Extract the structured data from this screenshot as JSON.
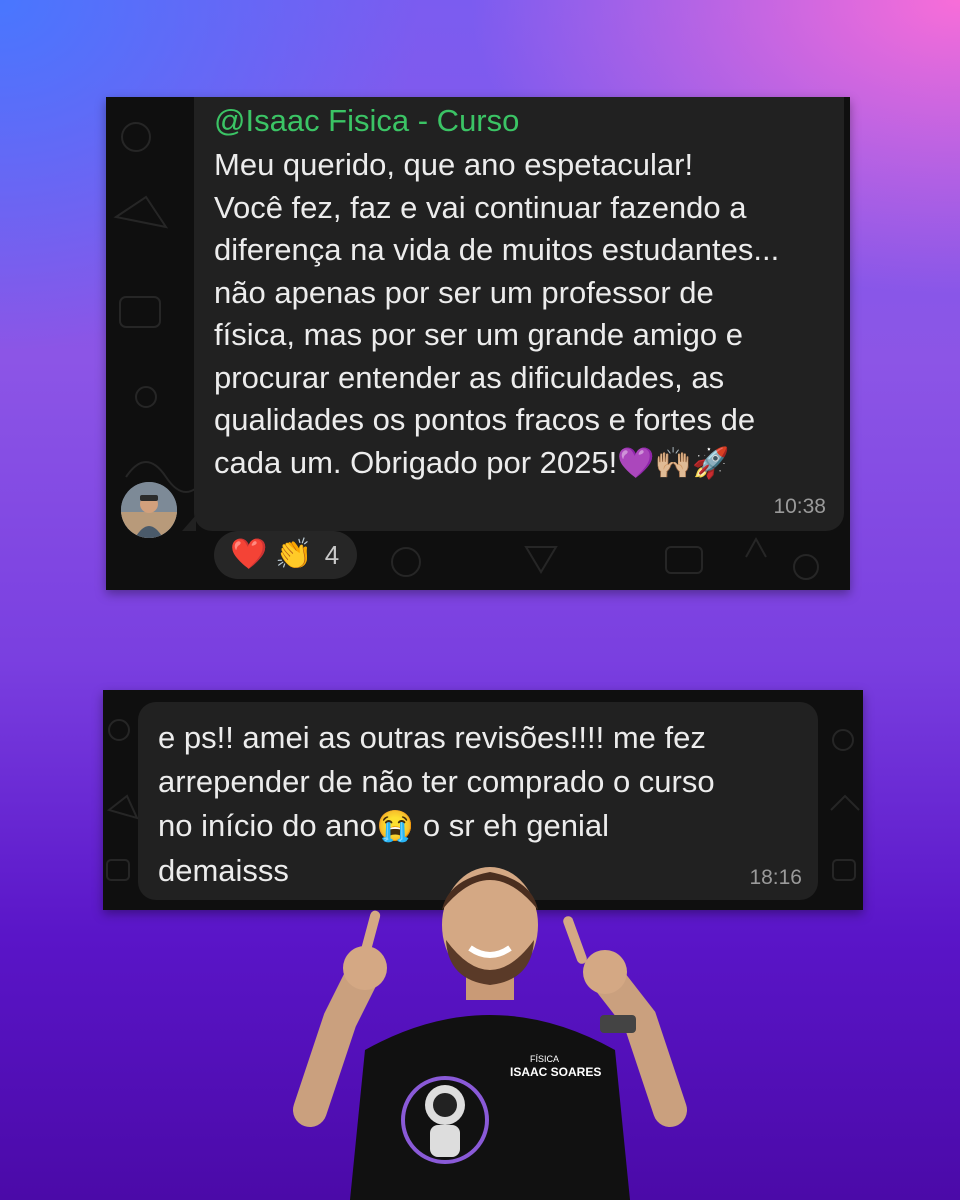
{
  "message1": {
    "sender": "@Isaac Fisica - Curso",
    "lines": [
      "Meu querido, que ano espetacular!",
      "Você fez, faz e vai continuar fazendo a",
      "diferença na vida de muitos estudantes...",
      "não apenas por ser um professor de",
      "física, mas por ser um grande amigo e",
      "procurar entender as dificuldades, as",
      "qualidades os pontos fracos e fortes de",
      "cada um. Obrigado por 2025!"
    ],
    "emojis": "💜🙌🏼🚀",
    "time": "10:38",
    "reactions": {
      "heart": "❤️",
      "clap": "👏",
      "count": "4"
    }
  },
  "message2": {
    "lines": [
      "e ps!! amei as outras revisões!!!! me fez",
      "arrepender de não ter comprado o curso",
      "no início do ano",
      "o sr eh genial",
      "demaisss"
    ],
    "emoji": "😭",
    "time": "18:16"
  },
  "shirt": {
    "top": "FÍSICA",
    "name": "ISAAC SOARES"
  },
  "icons": [
    "avatar-photo",
    "heart-reaction",
    "clap-reaction",
    "astronaut-logo"
  ]
}
